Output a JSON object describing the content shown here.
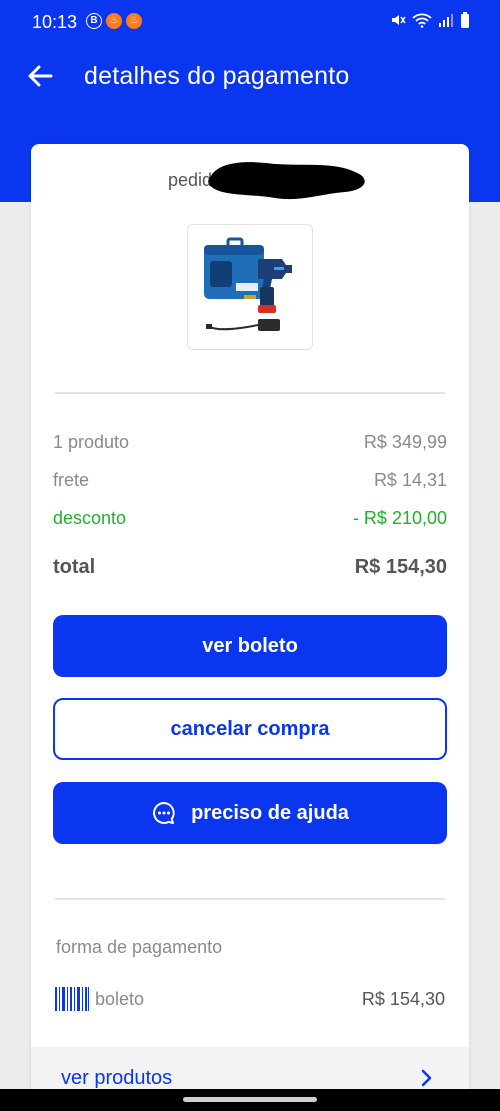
{
  "status_bar": {
    "time": "10:13",
    "notifications": [
      {
        "icon": "b-circle-icon",
        "glyph": "B"
      },
      {
        "icon": "flame-icon",
        "glyph": "♨"
      },
      {
        "icon": "flame-icon",
        "glyph": "♨"
      }
    ]
  },
  "header": {
    "back_icon": "arrow-left-icon",
    "title": "detalhes do pagamento"
  },
  "order": {
    "label": "pedido",
    "product_image": "bosch-drill-kit-image"
  },
  "summary": {
    "products_label": "1 produto",
    "products_value": "R$ 349,99",
    "shipping_label": "frete",
    "shipping_value": "R$ 14,31",
    "discount_label": "desconto",
    "discount_value": "- R$ 210,00",
    "total_label": "total",
    "total_value": "R$ 154,30"
  },
  "actions": {
    "view_boleto": "ver boleto",
    "cancel_purchase": "cancelar compra",
    "need_help": "preciso de ajuda",
    "help_icon": "chat-bubble-icon"
  },
  "payment": {
    "section_label": "forma de pagamento",
    "method_icon": "barcode-icon",
    "method": "boleto",
    "amount": "R$ 154,30"
  },
  "products_link": {
    "label": "ver produtos",
    "icon": "chevron-right-icon"
  },
  "colors": {
    "brand_blue": "#0a36ef",
    "discount_green": "#22b02a",
    "muted_text": "#8a8a8a"
  }
}
